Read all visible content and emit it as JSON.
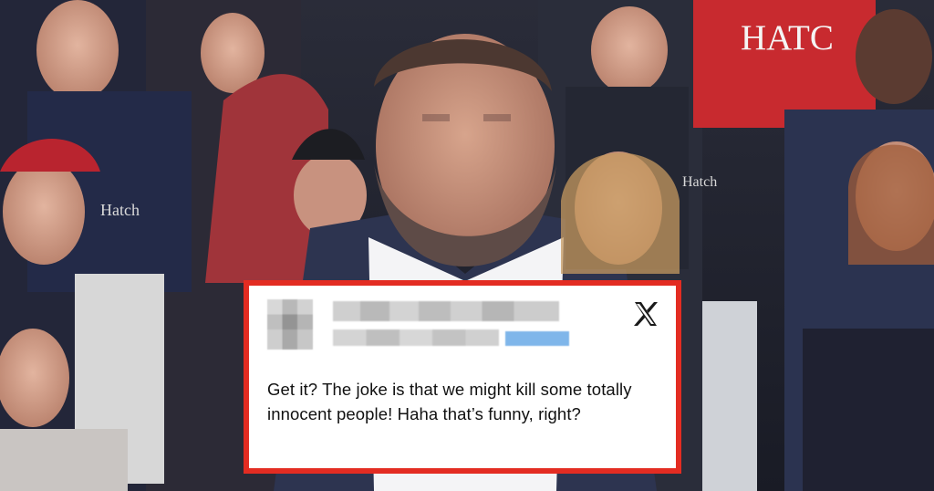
{
  "tweet": {
    "platform_icon": "x-logo-icon",
    "author_name_redacted": true,
    "author_handle_redacted": true,
    "text": "Get it? The joke is that we might kill some totally innocent people! Haha that’s funny, right?"
  },
  "colors": {
    "card_border": "#e32c22",
    "card_background": "#ffffff",
    "text": "#111111"
  },
  "background_scene": {
    "shirt_text_left": "Hatch",
    "shirt_text_right": "HATC",
    "center_shirt_text": "Hatch"
  }
}
